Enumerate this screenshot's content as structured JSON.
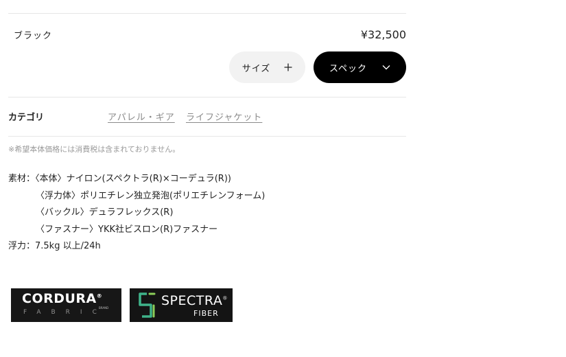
{
  "variant": {
    "color_name": "ブラック",
    "price": "¥32,500"
  },
  "buttons": {
    "size_label": "サイズ",
    "spec_label": "スペック"
  },
  "category": {
    "label": "カテゴリ",
    "links": [
      "アパレル・ギア",
      "ライフジャケット"
    ]
  },
  "note": "※希望本体価格には消費税は含まれておりません。",
  "specs": {
    "line1": "素材：〈本体〉ナイロン(スペクトラ(R)×コーデュラ(R))",
    "line2": "〈浮力体〉ポリエチレン独立発泡(ポリエチレンフォーム)",
    "line3": "〈バックル〉デュラフレックス(R)",
    "line4": "〈ファスナー〉YKK社ビスロン(R)ファスナー",
    "line5": "浮力：7.5kg 以上/24h"
  },
  "logos": {
    "cordura": {
      "word": "CORDURA",
      "reg": "®",
      "brand": "BRAND",
      "sub": "FABRIC"
    },
    "spectra": {
      "word": "SPECTRA",
      "reg": "®",
      "sub": "FIBER"
    }
  },
  "icons": {
    "size": "plus-icon",
    "spec": "chevron-down-icon"
  },
  "colors": {
    "spec_button_bg": "#000000",
    "size_button_bg": "#f2f2f2",
    "link": "#8a8a8a"
  }
}
